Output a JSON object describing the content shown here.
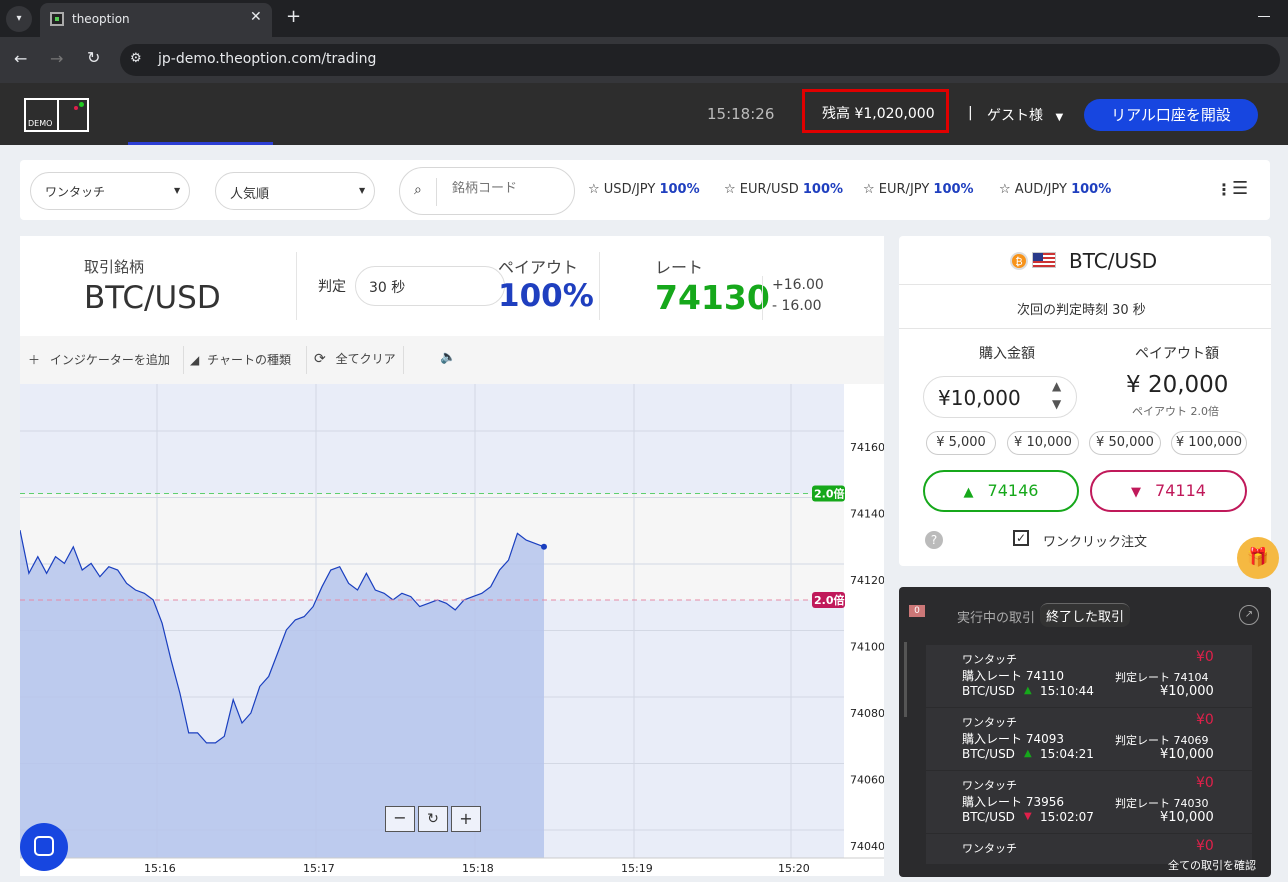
{
  "browser": {
    "tab_title": "theoption",
    "url": "jp-demo.theoption.com/trading"
  },
  "header": {
    "logo_text": "DEMO",
    "time": "15:18:26",
    "balance": "残高 ¥1,020,000",
    "separator": "|",
    "user": "ゲスト様",
    "open_account": "リアル口座を開設"
  },
  "toolbar": {
    "mode_select": "ワンタッチ",
    "sort_select": "人気順",
    "search_placeholder": "銘柄コード",
    "pairs": [
      {
        "name": "USD/JPY",
        "pct": "100%"
      },
      {
        "name": "EUR/USD",
        "pct": "100%"
      },
      {
        "name": "EUR/JPY",
        "pct": "100%"
      },
      {
        "name": "AUD/JPY",
        "pct": "100%"
      }
    ]
  },
  "instrument": {
    "label": "取引銘柄",
    "symbol": "BTC/USD",
    "judge_label": "判定",
    "judge_value": "30 秒",
    "payout_label": "ペイアウト",
    "payout_value": "100%",
    "rate_label": "レート",
    "rate_value": "74130",
    "rate_up": "+16.00",
    "rate_down": "- 16.00"
  },
  "chart_tools": {
    "add_indicator": "インジケーターを追加",
    "chart_type": "チャートの種類",
    "clear_all": "全てクリア"
  },
  "chart_data": {
    "type": "area",
    "x_ticks": [
      "15:16",
      "15:17",
      "15:18",
      "15:19",
      "15:20"
    ],
    "y_ticks": [
      "74160",
      "74140",
      "74120",
      "74100",
      "74080",
      "74060",
      "74040"
    ],
    "ylim": [
      74040,
      74160
    ],
    "upper_barrier": {
      "value": 74146,
      "label": "2.0倍"
    },
    "lower_barrier": {
      "value": 74114,
      "label": "2.0倍"
    },
    "series": [
      {
        "values": [
          74135,
          74122,
          74127,
          74122,
          74127,
          74125,
          74130,
          74123,
          74125,
          74121,
          74124,
          74123,
          74119,
          74117,
          74116,
          74114,
          74107,
          74096,
          74086,
          74074,
          74074,
          74071,
          74071,
          74073,
          74084,
          74077,
          74080,
          74088,
          74091,
          74098,
          74105,
          74108,
          74109,
          74112,
          74118,
          74123,
          74124,
          74119,
          74117,
          74122,
          74117,
          74116,
          74114,
          74116,
          74115,
          74112,
          74113,
          74114,
          74113,
          74111,
          74114,
          74115,
          74116,
          74118,
          74123,
          74126,
          74134,
          74132,
          74131,
          74130
        ]
      }
    ]
  },
  "order": {
    "pair": "BTC/USD",
    "next_judge": "次回の判定時刻 30 秒",
    "amount_label": "購入金額",
    "payout_label": "ペイアウト額",
    "amount": "¥10,000",
    "payout_amount": "¥ 20,000",
    "payout_multiplier": "ペイアウト 2.0倍",
    "chips": [
      "¥ 5,000",
      "¥ 10,000",
      "¥ 50,000",
      "¥ 100,000"
    ],
    "high_rate": "74146",
    "low_rate": "74114",
    "help": "?",
    "one_click": "ワンクリック注文",
    "colors": {
      "high": "#16a81b",
      "low": "#c0195a",
      "accent": "#1f3fbf"
    }
  },
  "trades": {
    "badge": "0",
    "tab_active": "実行中の取引",
    "tab_closed": "終了した取引",
    "see_all": "全ての取引を確認",
    "items": [
      {
        "type": "ワンタッチ",
        "profit": "¥0",
        "buy_rate": "購入レート 74110",
        "judge_rate": "判定レート 74104",
        "pair": "BTC/USD",
        "direction": "up",
        "time": "15:10:44",
        "amount": "¥10,000"
      },
      {
        "type": "ワンタッチ",
        "profit": "¥0",
        "buy_rate": "購入レート 74093",
        "judge_rate": "判定レート 74069",
        "pair": "BTC/USD",
        "direction": "up",
        "time": "15:04:21",
        "amount": "¥10,000"
      },
      {
        "type": "ワンタッチ",
        "profit": "¥0",
        "buy_rate": "購入レート 73956",
        "judge_rate": "判定レート 74030",
        "pair": "BTC/USD",
        "direction": "down",
        "time": "15:02:07",
        "amount": "¥10,000"
      },
      {
        "type": "ワンタッチ",
        "profit": "¥0"
      }
    ]
  }
}
